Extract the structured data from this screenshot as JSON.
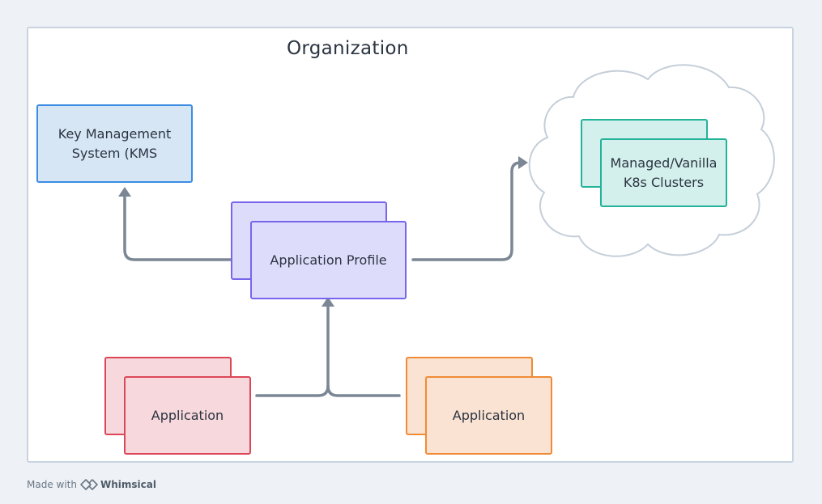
{
  "diagram": {
    "title": "Organization",
    "nodes": {
      "kms": {
        "label": "Key Management\nSystem (KMS"
      },
      "app_profile": {
        "label": "Application Profile"
      },
      "clusters": {
        "label": "Managed/Vanilla\nK8s Clusters"
      },
      "app_left": {
        "label": "Application"
      },
      "app_right": {
        "label": "Application"
      }
    },
    "edges": [
      {
        "from": "app_left",
        "to": "app_profile"
      },
      {
        "from": "app_right",
        "to": "app_profile"
      },
      {
        "from": "app_profile",
        "to": "kms"
      },
      {
        "from": "app_profile",
        "to": "clusters"
      }
    ],
    "colors": {
      "kms_fill": "#d6e6f5",
      "kms_stroke": "#3b8de3",
      "profile_fill": "#dedcfb",
      "profile_stroke": "#7766ec",
      "cluster_fill": "#d3f0ec",
      "cluster_stroke": "#23b39a",
      "app_left_fill": "#f7d8dc",
      "app_left_stroke": "#dc4757",
      "app_right_fill": "#fae3d3",
      "app_right_stroke": "#f08b34",
      "edge": "#7b8794",
      "cloud_stroke": "#c5ced9"
    }
  },
  "footer": {
    "prefix": "Made with",
    "brand": "Whimsical",
    "brand_icon": "whimsical-logo-icon"
  }
}
